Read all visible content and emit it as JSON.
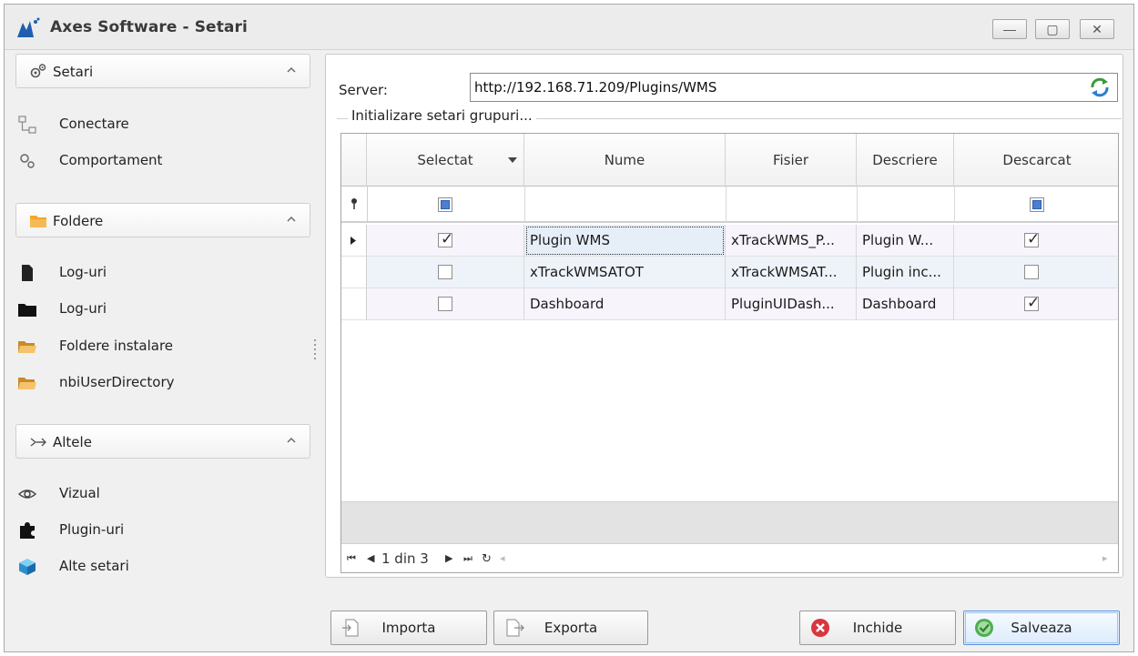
{
  "window": {
    "title": "Axes Software - Setari",
    "minimize_label": "—",
    "maximize_label": "▢",
    "close_label": "✕"
  },
  "sidebar": {
    "groups": [
      {
        "label": "Setari",
        "items": [
          {
            "label": "Conectare"
          },
          {
            "label": "Comportament"
          }
        ]
      },
      {
        "label": "Foldere",
        "items": [
          {
            "label": "Log-uri"
          },
          {
            "label": "Log-uri"
          },
          {
            "label": "Foldere instalare"
          },
          {
            "label": "nbiUserDirectory"
          }
        ]
      },
      {
        "label": "Altele",
        "items": [
          {
            "label": "Vizual"
          },
          {
            "label": "Plugin-uri"
          },
          {
            "label": "Alte setari"
          }
        ]
      }
    ]
  },
  "server": {
    "label": "Server:",
    "value": "http://192.168.71.209/Plugins/WMS"
  },
  "group_caption": "Initializare setari grupuri...",
  "grid": {
    "columns": [
      "Selectat",
      "Nume",
      "Fisier",
      "Descriere",
      "Descarcat"
    ],
    "rows": [
      {
        "selectat": true,
        "nume": "Plugin WMS",
        "fisier": "xTrackWMS_P...",
        "descriere": "Plugin W...",
        "descarcat": true
      },
      {
        "selectat": false,
        "nume": "xTrackWMSATOT",
        "fisier": "xTrackWMSAT...",
        "descriere": "Plugin inc...",
        "descarcat": false
      },
      {
        "selectat": false,
        "nume": "Dashboard",
        "fisier": "PluginUIDash...",
        "descriere": "Dashboard",
        "descarcat": true
      }
    ],
    "navigator_text": "1 din 3"
  },
  "buttons": {
    "importa": "Importa",
    "exporta": "Exporta",
    "inchide": "Inchide",
    "salveaza": "Salveaza"
  },
  "colors": {
    "accent_blue": "#4a7fd4",
    "close_red": "#d9363e",
    "save_green": "#4caf50",
    "folder_orange": "#f5a623"
  }
}
